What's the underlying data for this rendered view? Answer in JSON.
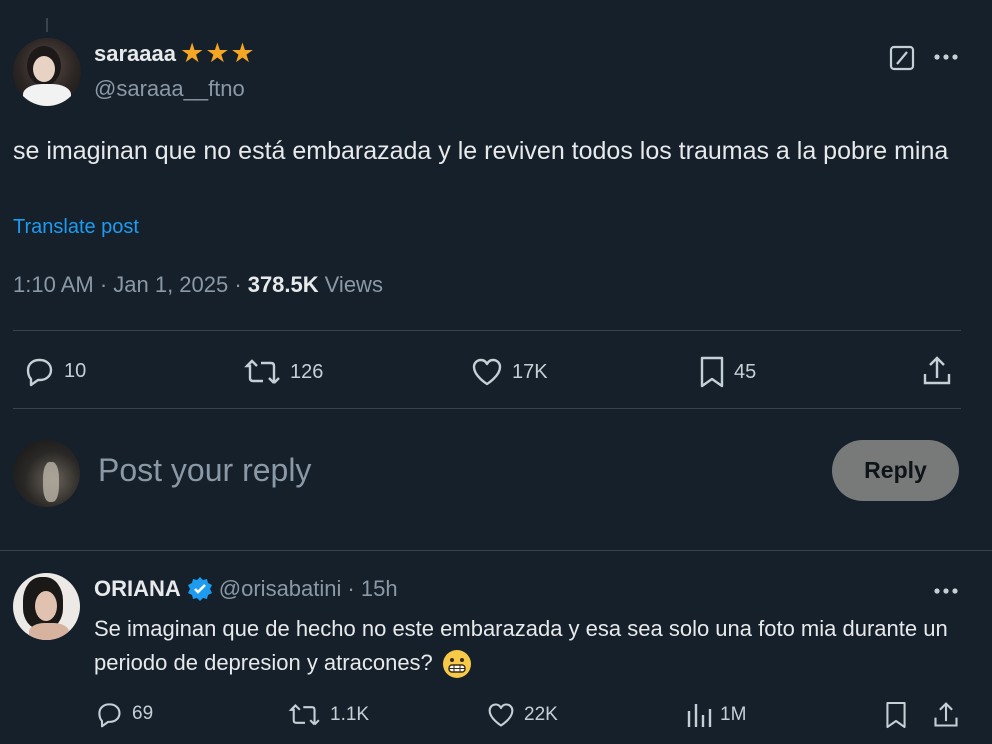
{
  "post": {
    "display_name": "saraaaa",
    "stars": "★★★",
    "handle": "@saraaa__ftno",
    "text": "se imaginan que no está embarazada y le reviven todos los traumas a la pobre mina",
    "translate_label": "Translate post",
    "timestamp": "1:10 AM · Jan 1, 2025 ·",
    "views_count": "378.5K",
    "views_label": "Views",
    "replies": "10",
    "reposts": "126",
    "likes": "17K",
    "bookmarks": "45"
  },
  "composer": {
    "placeholder": "Post your reply",
    "reply_button": "Reply"
  },
  "reply": {
    "display_name": "ORIANA",
    "handle": "@orisabatini",
    "time": "· 15h",
    "text": "Se imaginan que de hecho no este embarazada y esa sea solo una foto mia durante un periodo de depresion y atracones?",
    "emoji": "😬",
    "replies": "69",
    "reposts": "1.1K",
    "likes": "22K",
    "views": "1M"
  },
  "colors": {
    "background": "#15202b",
    "link": "#1d9bf0",
    "star": "#f5a623",
    "verified": "#1d9bf0",
    "reply_button_bg": "#787a7a"
  }
}
